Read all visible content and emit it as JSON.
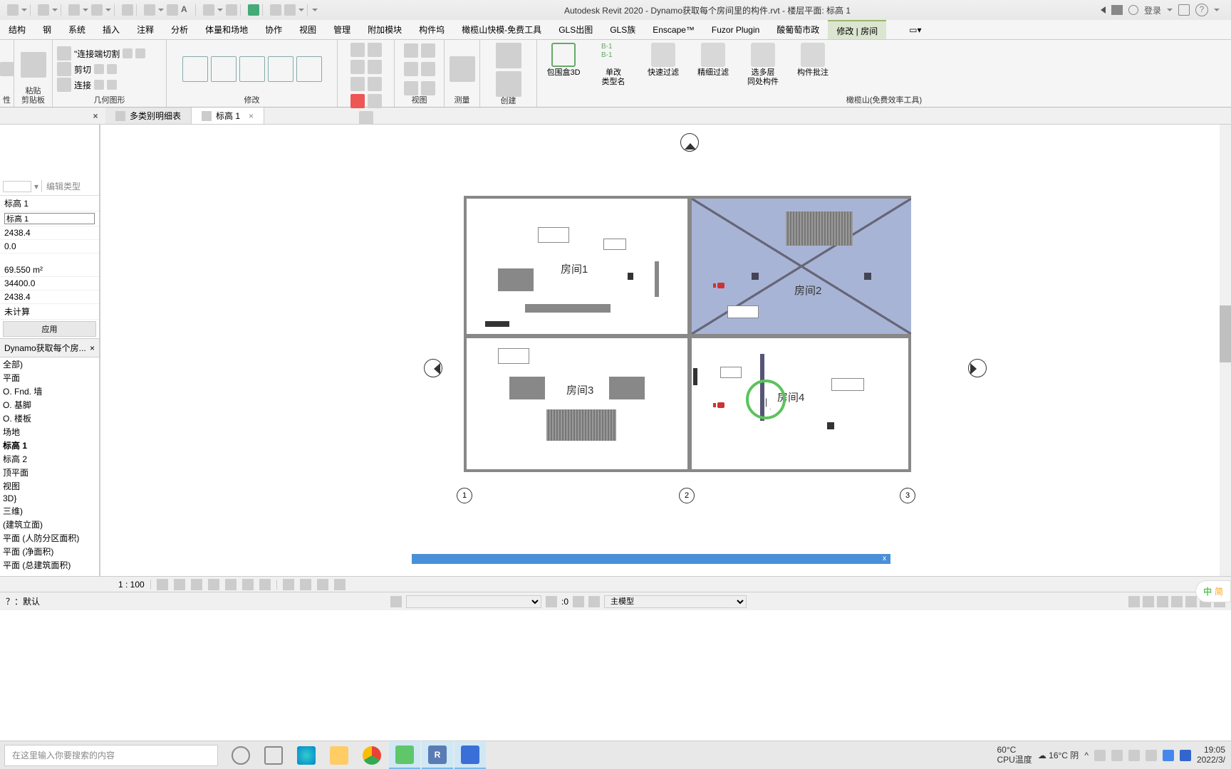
{
  "title": "Autodesk Revit 2020 - Dynamo获取每个房间里的构件.rvt - 楼层平面: 标高 1",
  "login": "登录",
  "menu": [
    "结构",
    "钢",
    "系统",
    "插入",
    "注释",
    "分析",
    "体量和场地",
    "协作",
    "视图",
    "管理",
    "附加模块",
    "构件坞",
    "橄榄山快模-免费工具",
    "GLS出图",
    "GLS族",
    "Enscape™",
    "Fuzor Plugin",
    "酸葡萄市政",
    "修改 | 房间"
  ],
  "ribbon_panels": {
    "paste": "粘贴",
    "clipboard": "剪贴板",
    "cut_end": "\"连接端切割",
    "cut": "剪切",
    "connect": "连接",
    "geom": "几何图形",
    "modify": "修改",
    "view": "视图",
    "measure": "测量",
    "create": "创建",
    "olive": "橄榄山(免费效率工具)",
    "box3d": "包围盒3D",
    "single_type": "单改\n类型名",
    "fast_filter": "快速过滤",
    "fine_filter": "精细过滤",
    "multi_floor": "选多层\n同处构件",
    "component_approve": "构件批注"
  },
  "tabs": {
    "schedule": "多类别明细表",
    "level": "标高 1"
  },
  "edit_type": "编辑类型",
  "props": {
    "p1": "标高 1",
    "p2": "标高 1",
    "p3": "2438.4",
    "p4": "0.0",
    "p5": "69.550 m²",
    "p6": "34400.0",
    "p7": "2438.4",
    "p8": "未计算",
    "apply": "应用"
  },
  "browser_title": "Dynamo获取每个房...",
  "browser": [
    "全部)",
    "平面",
    "O. Fnd. 墙",
    "O. 基脚",
    "O. 楼板",
    "场地",
    "标高 1",
    "标高 2",
    "顶平面",
    "视图",
    "3D}",
    "三维)",
    "(建筑立面)",
    "平面 (人防分区面积)",
    "平面 (净面积)",
    "平面 (总建筑面积)"
  ],
  "rooms": {
    "r1": "房间1",
    "r2": "房间2",
    "r3": "房间3",
    "r4": "房间4"
  },
  "grids": {
    "g1": "1",
    "g2": "2",
    "g3": "3"
  },
  "scale": "1 : 100",
  "status_default": "？：默认",
  "status2": {
    "zero": ":0",
    "main_model": "主模型"
  },
  "search_ph": "在这里输入你要搜索的内容",
  "tray": {
    "temp": "60°C",
    "cpu": "CPU温度",
    "weather": "16°C 阴",
    "time": "19:05",
    "date": "2022/3/"
  },
  "wm": {
    "a": "中",
    "b": "简"
  }
}
